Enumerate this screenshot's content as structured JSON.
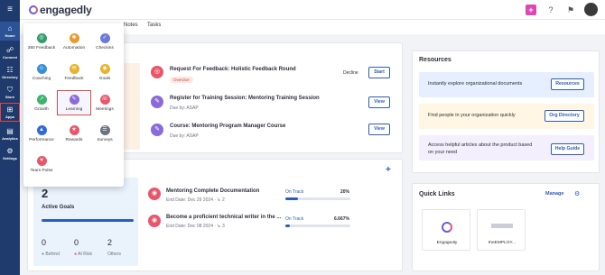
{
  "app": {
    "name": "engagedly"
  },
  "nav": {
    "items": [
      {
        "label": "Home",
        "icon": "home-icon",
        "glyph": "⌂"
      },
      {
        "label": "Connect",
        "icon": "connect-icon",
        "glyph": "☍"
      },
      {
        "label": "Directory",
        "icon": "directory-icon",
        "glyph": "☷"
      },
      {
        "label": "Store",
        "icon": "store-icon",
        "glyph": "⛉"
      },
      {
        "label": "Apps",
        "icon": "apps-icon",
        "glyph": "⊞"
      },
      {
        "label": "Analytics",
        "icon": "analytics-icon",
        "glyph": "▤"
      },
      {
        "label": "Settings",
        "icon": "settings-icon",
        "glyph": "⚙"
      }
    ]
  },
  "subtabs": {
    "notes": "Notes",
    "tasks": "Tasks"
  },
  "apps_menu": {
    "modules": [
      {
        "label": "360 Feedback",
        "icon": "feedback-360-icon",
        "color": "#2f9e6b",
        "glyph": "◎"
      },
      {
        "label": "Automation",
        "icon": "automation-icon",
        "color": "#e89a2b",
        "glyph": "✺"
      },
      {
        "label": "Checkins",
        "icon": "checkins-icon",
        "color": "#6b7bd8",
        "glyph": "✓"
      },
      {
        "label": "Coaching",
        "icon": "coaching-icon",
        "color": "#3a8fd8",
        "glyph": "☺"
      },
      {
        "label": "Feedback",
        "icon": "feedback-icon",
        "color": "#e8b22b",
        "glyph": "✉"
      },
      {
        "label": "Goals",
        "icon": "goals-icon",
        "color": "#e8b22b",
        "glyph": "◉"
      },
      {
        "label": "Growth",
        "icon": "growth-icon",
        "color": "#3bb36a",
        "glyph": "↗"
      },
      {
        "label": "Learning",
        "icon": "learning-icon",
        "color": "#8a6bd8",
        "glyph": "✎"
      },
      {
        "label": "Meetings",
        "icon": "meetings-icon",
        "color": "#e9566a",
        "glyph": "☏"
      },
      {
        "label": "Performance",
        "icon": "performance-icon",
        "color": "#2f6bd8",
        "glyph": "▲"
      },
      {
        "label": "Rewards",
        "icon": "rewards-icon",
        "color": "#e9566a",
        "glyph": "★"
      },
      {
        "label": "Surveys",
        "icon": "surveys-icon",
        "color": "#6b7280",
        "glyph": "☰"
      },
      {
        "label": "Team Pulse",
        "icon": "team-pulse-icon",
        "color": "#e9566a",
        "glyph": "♥"
      }
    ]
  },
  "tasks": [
    {
      "title": "Request For Feedback: Holistic Feedback Round",
      "badge": "Overdue",
      "secondary": "Decline",
      "action": "Start",
      "icon_color": "#e9566a"
    },
    {
      "title": "Register for Training Session: Mentoring Training Session",
      "due": "Due by: ASAP",
      "action": "View",
      "icon_color": "#8a6bd8"
    },
    {
      "title": "Course: Mentoring Program Manager Course",
      "due": "Due by: ASAP",
      "action": "View",
      "icon_color": "#8a6bd8"
    }
  ],
  "goals": {
    "count": "2",
    "label": "Active Goals",
    "stats": [
      {
        "value": "0",
        "label": "Behind",
        "color": "#3bb36a"
      },
      {
        "value": "0",
        "label": "At Risk",
        "color": "#e9566a"
      },
      {
        "value": "2",
        "label": "Others",
        "color": "#9aa1ad"
      }
    ],
    "items": [
      {
        "title": "Mentoring Complete Documentation",
        "meta": "End Date: Dec 29 2024 · ↳ 2",
        "status": "On Track",
        "percent": "20%",
        "progress": 0.2
      },
      {
        "title": "Become a proficient technical writer in the ...",
        "meta": "End Date: Dec 08 2024 · ↳ 3",
        "status": "On Track",
        "percent": "6.667%",
        "progress": 0.067
      }
    ]
  },
  "resources": {
    "title": "Resources",
    "rows": [
      {
        "text": "Instantly explore organizational documents",
        "button": "Resources",
        "bg": "#e6efff"
      },
      {
        "text": "Find people in your organization quickly",
        "button": "Org Directory",
        "bg": "#fff6e3"
      },
      {
        "text": "Access helpful articles about the product based on your need",
        "button": "Help Guide",
        "bg": "#f3effd"
      }
    ]
  },
  "quick_links": {
    "title": "Quick Links",
    "manage": "Manage",
    "tiles": [
      {
        "label": "Engagedly"
      },
      {
        "label": "theEMPLOY..."
      }
    ]
  }
}
